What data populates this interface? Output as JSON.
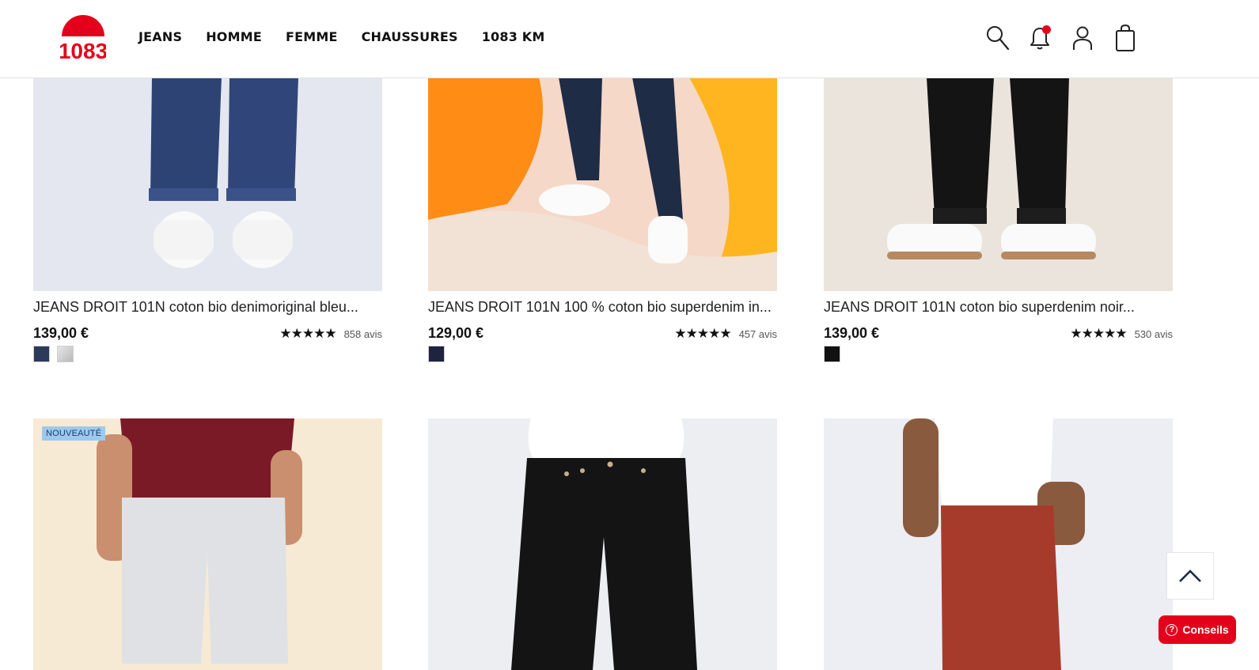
{
  "brand": {
    "logo_text": "1083",
    "accent_color": "#e4001b"
  },
  "nav": [
    "JEANS",
    "HOMME",
    "FEMME",
    "CHAUSSURES",
    "1083 KM"
  ],
  "header_icons": [
    "search-icon",
    "bell-icon",
    "user-icon",
    "bag-icon"
  ],
  "products": [
    {
      "title": "JEANS DROIT 101N coton bio denimoriginal bleu...",
      "price": "139,00 €",
      "stars": "★★★★★",
      "reviews": "858 avis",
      "swatches": [
        "#2b3a5a",
        "#c9c9c9"
      ]
    },
    {
      "title": "JEANS DROIT 101N 100 % coton bio superdenim in...",
      "price": "129,00 €",
      "stars": "★★★★★",
      "reviews": "457 avis",
      "swatches": [
        "#1e2340"
      ]
    },
    {
      "title": "JEANS DROIT 101N coton bio superdenim noir...",
      "price": "139,00 €",
      "stars": "★★★★★",
      "reviews": "530 avis",
      "swatches": [
        "#111111"
      ]
    }
  ],
  "lower_products": [
    {
      "badge": "NOUVEAUTÉ"
    },
    {
      "badge": ""
    },
    {
      "badge": ""
    }
  ],
  "conseils_label": "Conseils",
  "conseils_icon": "?"
}
